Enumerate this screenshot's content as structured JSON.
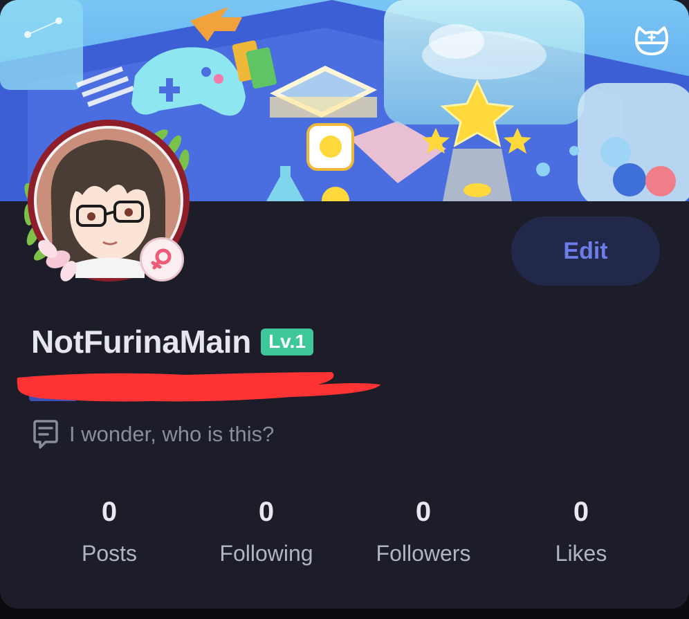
{
  "profile": {
    "username": "NotFurinaMain",
    "level_badge": "Lv.1",
    "bio": "I wonder, who is this?",
    "gender_badge_icon": "female-symbol-icon"
  },
  "actions": {
    "edit_label": "Edit",
    "mascot_icon": "cat-mascot-icon"
  },
  "stats": [
    {
      "count": "0",
      "label": "Posts"
    },
    {
      "count": "0",
      "label": "Following"
    },
    {
      "count": "0",
      "label": "Followers"
    },
    {
      "count": "0",
      "label": "Likes"
    }
  ],
  "colors": {
    "card_background": "#1c1d29",
    "accent_edit_text": "#6d7de8",
    "edit_button_bg": "#22284a",
    "level_badge_bg": "#3ec79b",
    "redaction": "#ff3333",
    "banner_sky": "#5ab0f0"
  }
}
